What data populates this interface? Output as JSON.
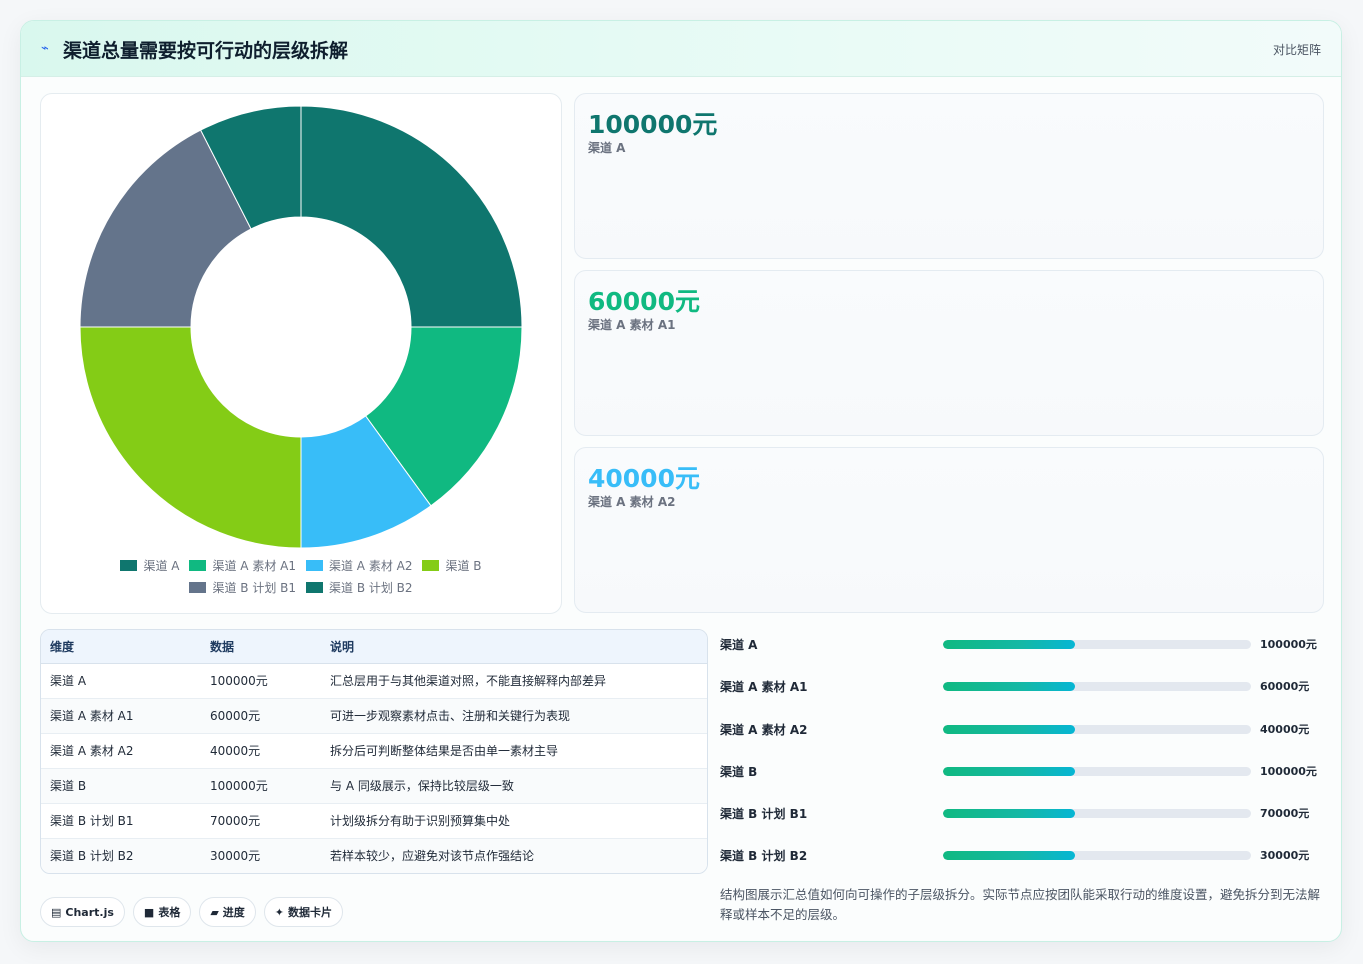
{
  "header": {
    "icon": "chart-line-icon",
    "title": "渠道总量需要按可行动的层级拆解",
    "right_label": "对比矩阵"
  },
  "colors": {
    "dark_teal": "#0f766e",
    "green": "#10b981",
    "sky": "#38bdf8",
    "lime": "#84cc16",
    "slate": "#64748b"
  },
  "chart_data": {
    "type": "doughnut",
    "title": "",
    "categories": [
      "渠道 A",
      "渠道 A 素材 A1",
      "渠道 A 素材 A2",
      "渠道 B",
      "渠道 B 计划 B1",
      "渠道 B 计划 B2"
    ],
    "values": [
      100000,
      60000,
      40000,
      100000,
      70000,
      30000
    ],
    "colors": [
      "#0f766e",
      "#10b981",
      "#38bdf8",
      "#84cc16",
      "#64748b",
      "#0f766e"
    ],
    "legend": "bottom"
  },
  "stats": [
    {
      "value": "100000元",
      "label": "渠道 A",
      "color": "#0f766e"
    },
    {
      "value": "60000元",
      "label": "渠道 A 素材 A1",
      "color": "#10b981"
    },
    {
      "value": "40000元",
      "label": "渠道 A 素材 A2",
      "color": "#38bdf8"
    }
  ],
  "table": {
    "headers": [
      "维度",
      "数据",
      "说明"
    ],
    "rows": [
      [
        "渠道 A",
        "100000元",
        "汇总层用于与其他渠道对照，不能直接解释内部差异"
      ],
      [
        "渠道 A 素材 A1",
        "60000元",
        "可进一步观察素材点击、注册和关键行为表现"
      ],
      [
        "渠道 A 素材 A2",
        "40000元",
        "拆分后可判断整体结果是否由单一素材主导"
      ],
      [
        "渠道 B",
        "100000元",
        "与 A 同级展示，保持比较层级一致"
      ],
      [
        "渠道 B 计划 B1",
        "70000元",
        "计划级拆分有助于识别预算集中处"
      ],
      [
        "渠道 B 计划 B2",
        "30000元",
        "若样本较少，应避免对该节点作强结论"
      ]
    ]
  },
  "chips": [
    {
      "icon": "▤",
      "label": "Chart.js"
    },
    {
      "icon": "■",
      "label": "表格"
    },
    {
      "icon": "▰",
      "label": "进度"
    },
    {
      "icon": "✦",
      "label": "数据卡片"
    }
  ],
  "progress": [
    {
      "label": "渠道 A",
      "value": "100000元",
      "fraction": 0.43
    },
    {
      "label": "渠道 A 素材 A1",
      "value": "60000元",
      "fraction": 0.43
    },
    {
      "label": "渠道 A 素材 A2",
      "value": "40000元",
      "fraction": 0.43
    },
    {
      "label": "渠道 B",
      "value": "100000元",
      "fraction": 0.43
    },
    {
      "label": "渠道 B 计划 B1",
      "value": "70000元",
      "fraction": 0.43
    },
    {
      "label": "渠道 B 计划 B2",
      "value": "30000元",
      "fraction": 0.43
    }
  ],
  "note": "结构图展示汇总值如何向可操作的子层级拆分。实际节点应按团队能采取行动的维度设置，避免拆分到无法解释或样本不足的层级。"
}
